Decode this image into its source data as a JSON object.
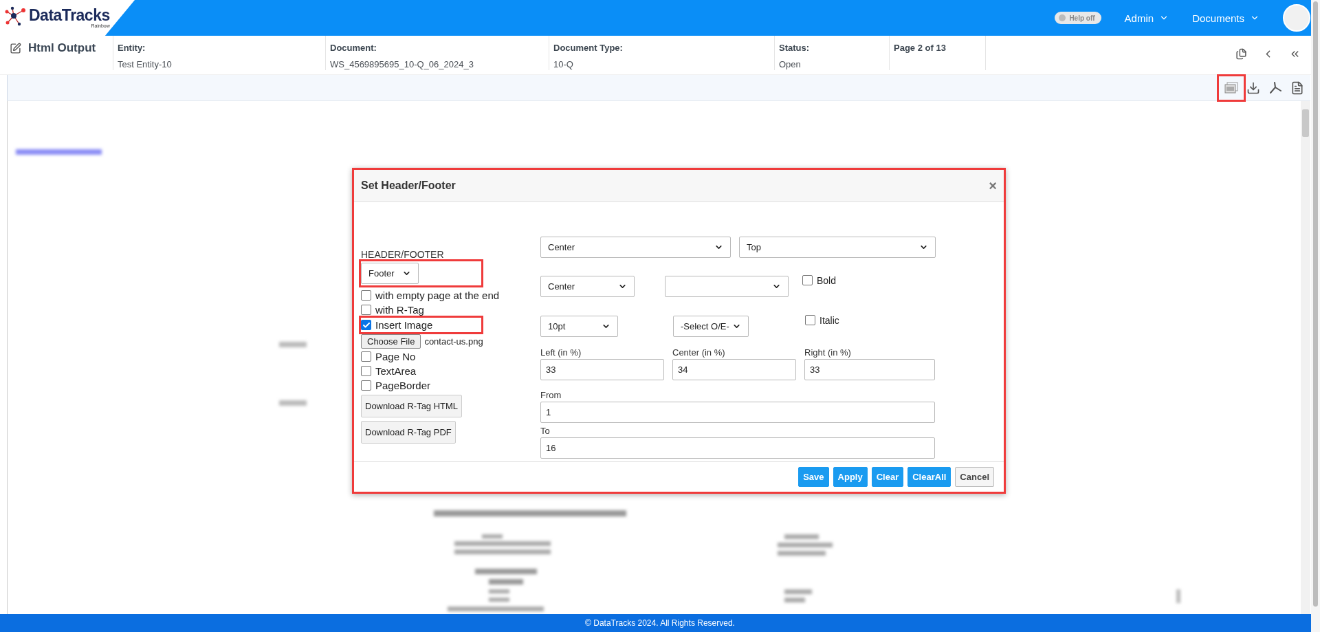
{
  "header": {
    "logo": {
      "name": "DataTracks",
      "tagline": "Rainbow"
    },
    "help_toggle": {
      "label": "Help off",
      "on": false
    },
    "menus": [
      {
        "label": "Admin"
      },
      {
        "label": "Documents"
      }
    ]
  },
  "page": {
    "title": "Html Output",
    "fields": [
      {
        "label": "Entity:",
        "value": "Test Entity-10"
      },
      {
        "label": "Document:",
        "value": "WS_4569895695_10-Q_06_2024_3"
      },
      {
        "label": "Document Type:",
        "value": "10-Q"
      },
      {
        "label": "Status:",
        "value": "Open"
      },
      {
        "label": "Page 2 of 13"
      }
    ],
    "nav": [
      {
        "kind": "copy"
      },
      {
        "kind": "prev"
      },
      {
        "kind": "first"
      }
    ],
    "tools": [
      {
        "kind": "preview",
        "highlighted": true
      },
      {
        "kind": "download",
        "highlighted": false
      },
      {
        "kind": "pdf",
        "highlighted": false
      },
      {
        "kind": "word",
        "highlighted": false
      }
    ]
  },
  "dialog": {
    "title": "Set Header/Footer",
    "close": "×",
    "highlighted": true,
    "section_label": "HEADER/FOOTER",
    "type_select": {
      "value": "Footer",
      "highlighted": true
    },
    "options": [
      {
        "kind": "checkbox",
        "label": "with empty page at the end",
        "checked": false,
        "highlighted": false
      },
      {
        "kind": "checkbox",
        "label": "with R-Tag",
        "checked": false,
        "highlighted": false
      },
      {
        "kind": "checkbox",
        "label": "Insert Image",
        "checked": true,
        "highlighted": true
      },
      {
        "kind": "file",
        "button": "Choose File",
        "file_name": "contact-us.png"
      },
      {
        "kind": "checkbox",
        "label": "Page No",
        "checked": false,
        "highlighted": false
      },
      {
        "kind": "checkbox",
        "label": "TextArea",
        "checked": false,
        "highlighted": false
      },
      {
        "kind": "checkbox",
        "label": "PageBorder",
        "checked": false,
        "highlighted": false
      }
    ],
    "download_buttons": [
      "Download R-Tag HTML",
      "Download R-Tag PDF"
    ],
    "rows": [
      {
        "selects": [
          {
            "kind": "filled",
            "value": "Center"
          },
          {
            "kind": "filled",
            "value": "Top"
          }
        ]
      },
      {
        "selects": [
          {
            "kind": "filled",
            "value": "Center"
          },
          {
            "kind": "blank"
          }
        ],
        "checkbox": {
          "label": "Bold",
          "checked": false
        }
      },
      {
        "selects": [
          {
            "kind": "filled",
            "value": "10pt"
          },
          {
            "kind": "filled",
            "value": "-Select O/E-"
          }
        ],
        "checkbox": {
          "label": "Italic",
          "checked": false
        }
      }
    ],
    "widths": [
      {
        "label": "Left (in %)",
        "value": "33"
      },
      {
        "label": "Center (in %)",
        "value": "34"
      },
      {
        "label": "Right (in %)",
        "value": "33"
      }
    ],
    "range": [
      {
        "label": "From",
        "value": "1"
      },
      {
        "label": "To",
        "value": "16"
      }
    ],
    "buttons": [
      {
        "label": "Save",
        "kind": "primary"
      },
      {
        "label": "Apply",
        "kind": "primary"
      },
      {
        "label": "Clear",
        "kind": "primary"
      },
      {
        "label": "ClearAll",
        "kind": "primary"
      },
      {
        "label": "Cancel",
        "kind": "secondary"
      }
    ]
  },
  "footer": {
    "text": "© DataTracks 2024. All Rights Reserved."
  }
}
